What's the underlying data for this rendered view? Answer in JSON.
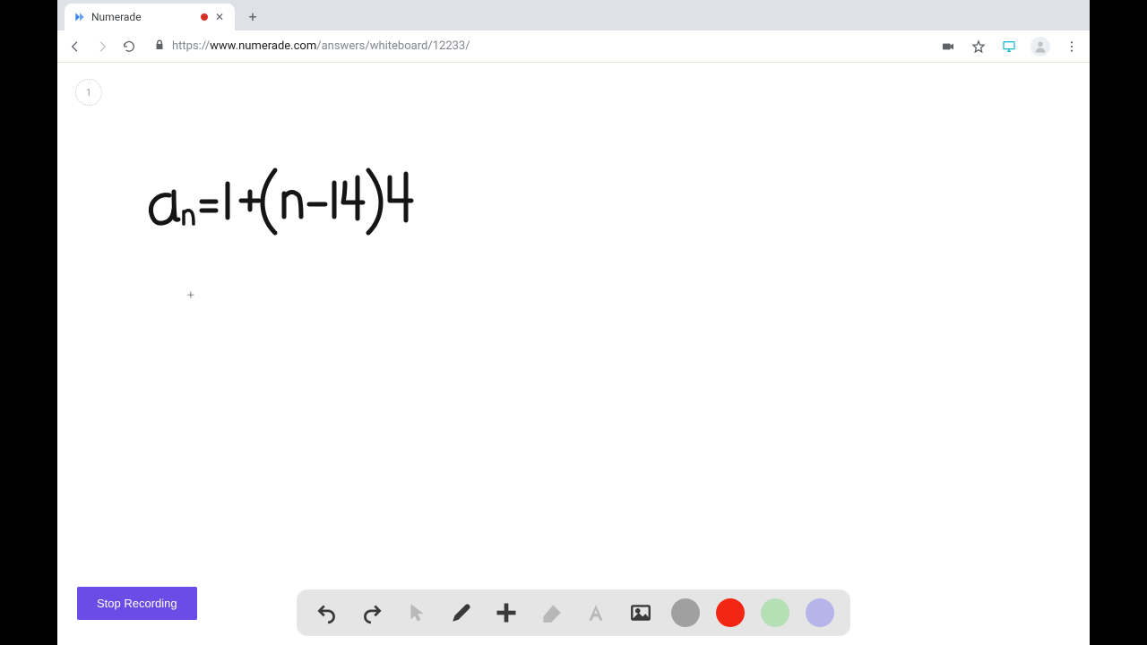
{
  "tab": {
    "title": "Numerade",
    "recording": true
  },
  "address": {
    "protocol": "https://",
    "host": "www.numerade.com",
    "path": "/answers/whiteboard/12233/"
  },
  "page_badge": "1",
  "whiteboard": {
    "equation_label": "a_n = 1 + (n - 14)4",
    "cursor_glyph": "+"
  },
  "buttons": {
    "stop_recording": "Stop Recording"
  },
  "toolbar": {
    "tools": [
      "undo",
      "redo",
      "pointer",
      "pen",
      "insert",
      "eraser",
      "text",
      "image"
    ],
    "colors": {
      "gray": "#a0a0a0",
      "red": "#f22613",
      "green": "#b5e0b5",
      "purple": "#b5b5ea"
    },
    "selected_color": "red"
  }
}
